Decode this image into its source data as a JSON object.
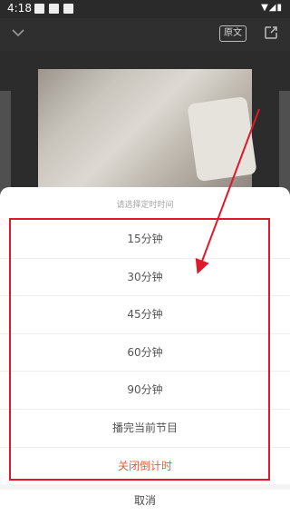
{
  "status_bar": {
    "time": "4:18",
    "right": "▼◢▮"
  },
  "top_bar": {
    "original_label": "原文"
  },
  "sheet": {
    "title": "请选择定时时间",
    "options": [
      "15分钟",
      "30分钟",
      "45分钟",
      "60分钟",
      "90分钟",
      "播完当前节目",
      "关闭倒计时"
    ],
    "cancel_label": "取消"
  },
  "colors": {
    "annotation": "#e0192a",
    "danger": "#ee5a3e"
  }
}
